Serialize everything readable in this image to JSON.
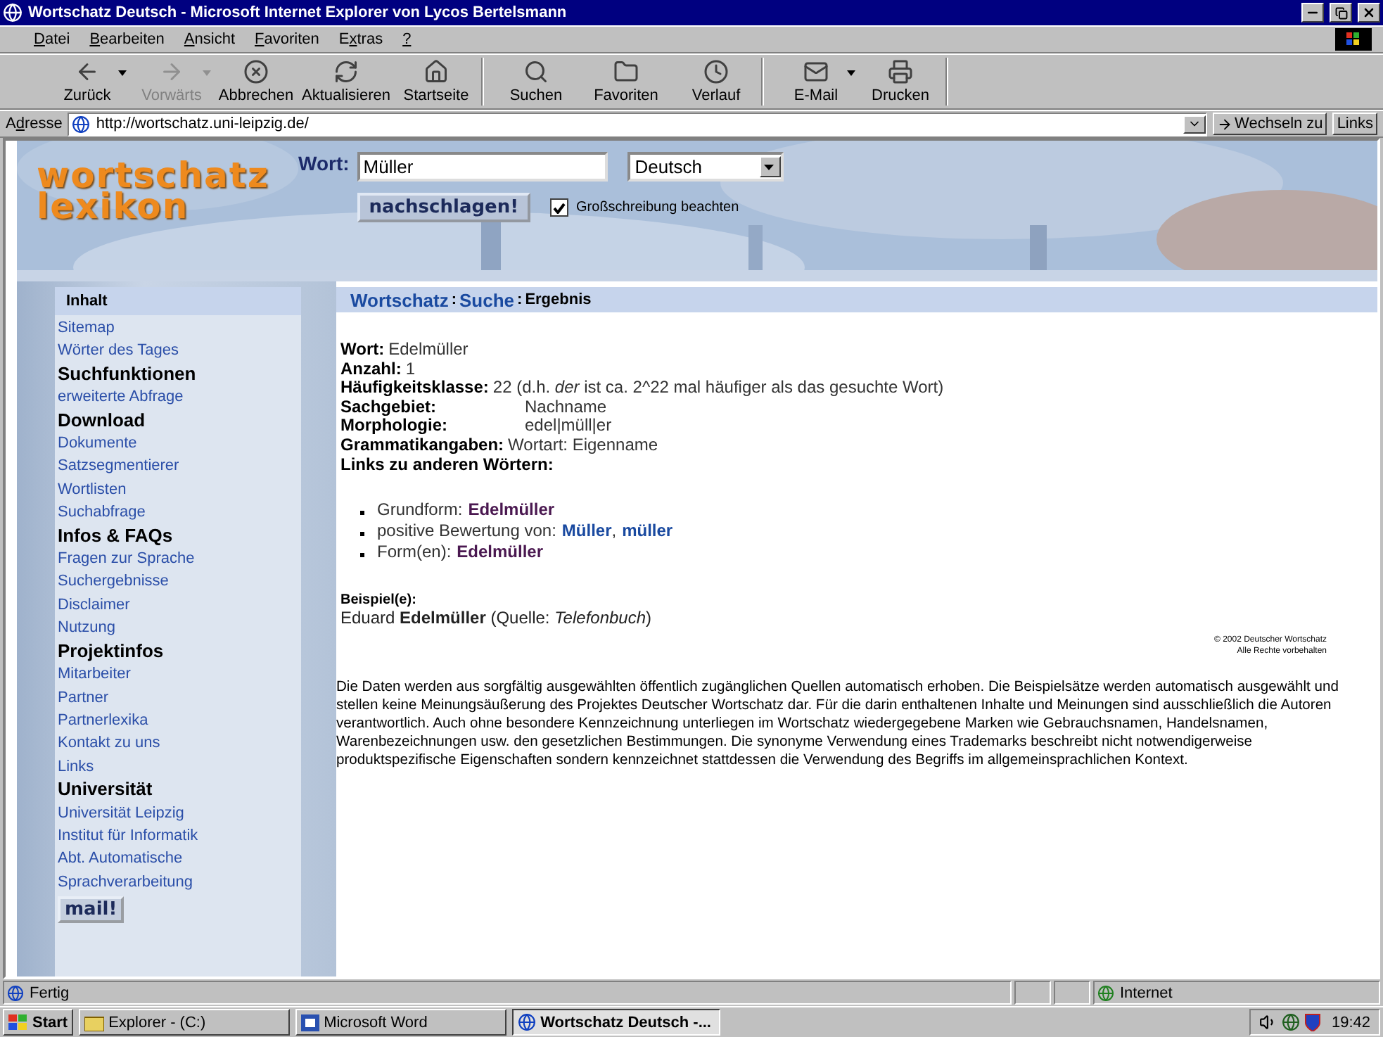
{
  "window": {
    "title": "Wortschatz Deutsch - Microsoft Internet Explorer von Lycos Bertelsmann"
  },
  "menu": [
    {
      "key": "D",
      "post": "atei"
    },
    {
      "key": "B",
      "post": "earbeiten"
    },
    {
      "key": "A",
      "post": "nsicht"
    },
    {
      "key": "F",
      "post": "avoriten"
    },
    {
      "pre": "E",
      "key": "x",
      "post": "tras"
    },
    {
      "key": "?"
    }
  ],
  "toolbar": [
    [
      {
        "kind": "back",
        "label": "Zurück",
        "disabled": false,
        "dropdown": true
      },
      {
        "kind": "forward",
        "label": "Vorwärts",
        "disabled": true,
        "dropdown": true
      },
      {
        "kind": "stop",
        "label": "Abbrechen",
        "disabled": false,
        "dropdown": false
      },
      {
        "kind": "refresh",
        "label": "Aktualisieren",
        "disabled": false,
        "dropdown": false
      },
      {
        "kind": "home",
        "label": "Startseite",
        "disabled": false,
        "dropdown": false
      }
    ],
    [
      {
        "kind": "search",
        "label": "Suchen",
        "disabled": false,
        "dropdown": false
      },
      {
        "kind": "favorites",
        "label": "Favoriten",
        "disabled": false,
        "dropdown": false
      },
      {
        "kind": "history",
        "label": "Verlauf",
        "disabled": false,
        "dropdown": false
      }
    ],
    [
      {
        "kind": "mail",
        "label": "E-Mail",
        "disabled": false,
        "dropdown": true
      },
      {
        "kind": "print",
        "label": "Drucken",
        "disabled": false,
        "dropdown": false
      }
    ]
  ],
  "address": {
    "pre": "A",
    "key": "d",
    "post": "resse",
    "url": "http://wortschatz.uni-leipzig.de/",
    "go": "Wechseln zu",
    "links": "Links"
  },
  "header": {
    "logo": [
      "wortschatz",
      "lexikon"
    ],
    "word_label": "Wort:",
    "word_value": "Müller",
    "language": "Deutsch",
    "submit": "nachschlagen!",
    "checkbox": {
      "label": "Großschreibung beachten",
      "checked": true
    }
  },
  "breadcrumb": {
    "separator": ":",
    "items": [
      {
        "text": "Wortschatz",
        "kind": "link"
      },
      {
        "text": "Suche",
        "kind": "link"
      },
      {
        "text": "Ergebnis",
        "kind": "current"
      }
    ]
  },
  "sidebar": {
    "title": "Inhalt",
    "items": [
      {
        "text": "Sitemap",
        "kind": "link"
      },
      {
        "text": "Wörter des Tages",
        "kind": "link"
      },
      {
        "text": "Suchfunktionen",
        "kind": "heading"
      },
      {
        "text": "erweiterte Abfrage",
        "kind": "link"
      },
      {
        "text": "Download",
        "kind": "heading"
      },
      {
        "text": "Dokumente",
        "kind": "link"
      },
      {
        "text": "Satzsegmentierer",
        "kind": "link"
      },
      {
        "text": "Wortlisten",
        "kind": "link"
      },
      {
        "text": "Suchabfrage",
        "kind": "link"
      },
      {
        "text": "Infos & FAQs",
        "kind": "heading"
      },
      {
        "text": "Fragen zur Sprache",
        "kind": "link"
      },
      {
        "text": "Suchergebnisse",
        "kind": "link"
      },
      {
        "text": "Disclaimer",
        "kind": "link"
      },
      {
        "text": "Nutzung",
        "kind": "link"
      },
      {
        "text": "Projektinfos",
        "kind": "heading"
      },
      {
        "text": "Mitarbeiter",
        "kind": "link"
      },
      {
        "text": "Partner",
        "kind": "link"
      },
      {
        "text": "Partnerlexika",
        "kind": "link"
      },
      {
        "text": "Kontakt zu uns",
        "kind": "link"
      },
      {
        "text": "Links",
        "kind": "link"
      },
      {
        "text": "Universität",
        "kind": "heading"
      },
      {
        "text": "Universität Leipzig",
        "kind": "link"
      },
      {
        "text": "Institut für Informatik",
        "kind": "link"
      },
      {
        "text": "Abt. Automatische",
        "kind": "link"
      },
      {
        "text": "Sprachverarbeitung",
        "kind": "link"
      }
    ],
    "mail": "mail!"
  },
  "result": {
    "fields": [
      {
        "label": "Wort:",
        "value": "Edelmüller",
        "kind": "inline"
      },
      {
        "label": "Anzahl:",
        "value": "1",
        "kind": "inline"
      },
      {
        "label": "Häufigkeitsklasse:",
        "value": "22 (d.h. *der* ist ca. 2^22 mal häufiger als das gesuchte Wort)",
        "kind": "inline"
      },
      {
        "label": "Sachgebiet:",
        "value": "Nachname",
        "kind": "tabular"
      },
      {
        "label": "Morphologie:",
        "value": "edel|müll|er",
        "kind": "tabular"
      },
      {
        "label": "Grammatikangaben:",
        "value": "Wortart: Eigenname",
        "kind": "inline"
      }
    ],
    "links_heading": "Links zu anderen Wörtern:",
    "link_separator": ",",
    "links": [
      {
        "prefix": "Grundform:",
        "targets": [
          {
            "text": "Edelmüller",
            "visited": true
          }
        ]
      },
      {
        "prefix": "positive Bewertung von:",
        "targets": [
          {
            "text": "Müller",
            "visited": false
          },
          {
            "text": "müller",
            "visited": false
          }
        ]
      },
      {
        "prefix": "Form(en):",
        "targets": [
          {
            "text": "Edelmüller",
            "visited": true
          }
        ]
      }
    ],
    "example_heading": "Beispiel(e):",
    "example": "Eduard **Edelmüller** (Quelle: *Telefonbuch*)"
  },
  "copyright": [
    "© 2002 Deutscher Wortschatz",
    "Alle Rechte vorbehalten"
  ],
  "disclaimer": "Die Daten werden aus sorgfältig ausgewählten öffentlich zugänglichen Quellen automatisch erhoben. Die Beispielsätze werden automatisch ausgewählt und stellen keine Meinungsäußerung des Projektes Deutscher Wortschatz dar. Für die darin enthaltenen Inhalte und Meinungen sind ausschließlich die Autoren verantwortlich. Auch ohne besondere Kennzeichnung unterliegen im Wortschatz wiedergegebene Marken wie Gebrauchsnamen, Handelsnamen, Warenbezeichnungen usw. den gesetzlichen Bestimmungen. Die synonyme Verwendung eines Trademarks beschreibt nicht notwendigerweise produktspezifische Eigenschaften sondern kennzeichnet stattdessen die Verwendung des Begriffs im allgemeinsprachlichen Kontext.",
  "status": {
    "text": "Fertig",
    "zone": "Internet"
  },
  "taskbar": {
    "start": "Start",
    "tasks": [
      {
        "label": "Explorer - (C:)",
        "kind": "explorer",
        "active": false
      },
      {
        "label": "Microsoft Word",
        "kind": "word",
        "active": false
      },
      {
        "label": "Wortschatz Deutsch -...",
        "kind": "browser",
        "active": true
      }
    ],
    "clock": "19:42"
  }
}
